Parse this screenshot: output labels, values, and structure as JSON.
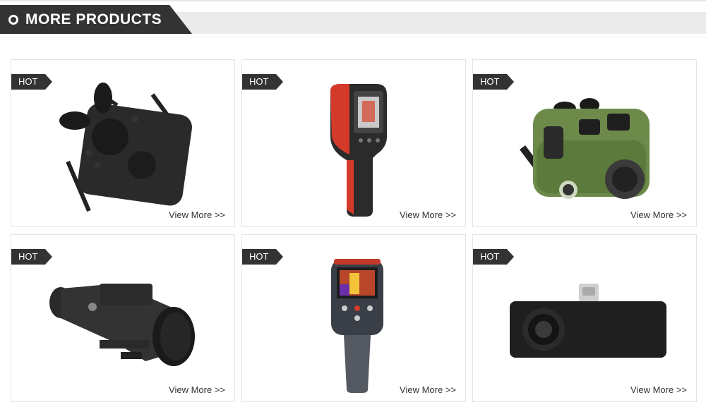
{
  "section": {
    "title": "MORE PRODUCTS",
    "icon": "circle-bullet-icon"
  },
  "products": [
    {
      "badge": "HOT",
      "link": "View More >>",
      "icon": "thermal-binocular-icon"
    },
    {
      "badge": "HOT",
      "link": "View More >>",
      "icon": "handheld-thermal-camera-icon"
    },
    {
      "badge": "HOT",
      "link": "View More >>",
      "icon": "green-thermal-binocular-icon"
    },
    {
      "badge": "HOT",
      "link": "View More >>",
      "icon": "thermal-rifle-scope-icon"
    },
    {
      "badge": "HOT",
      "link": "View More >>",
      "icon": "thermal-imaging-camera-icon"
    },
    {
      "badge": "HOT",
      "link": "View More >>",
      "icon": "usb-c-thermal-module-icon"
    }
  ],
  "colors": {
    "header_tab": "#333333",
    "header_band": "#ebebeb",
    "badge": "#333333",
    "card_border": "#e3e3e3",
    "camera_accent": "#d43a2a",
    "binocular_green": "#6d8a4a"
  }
}
